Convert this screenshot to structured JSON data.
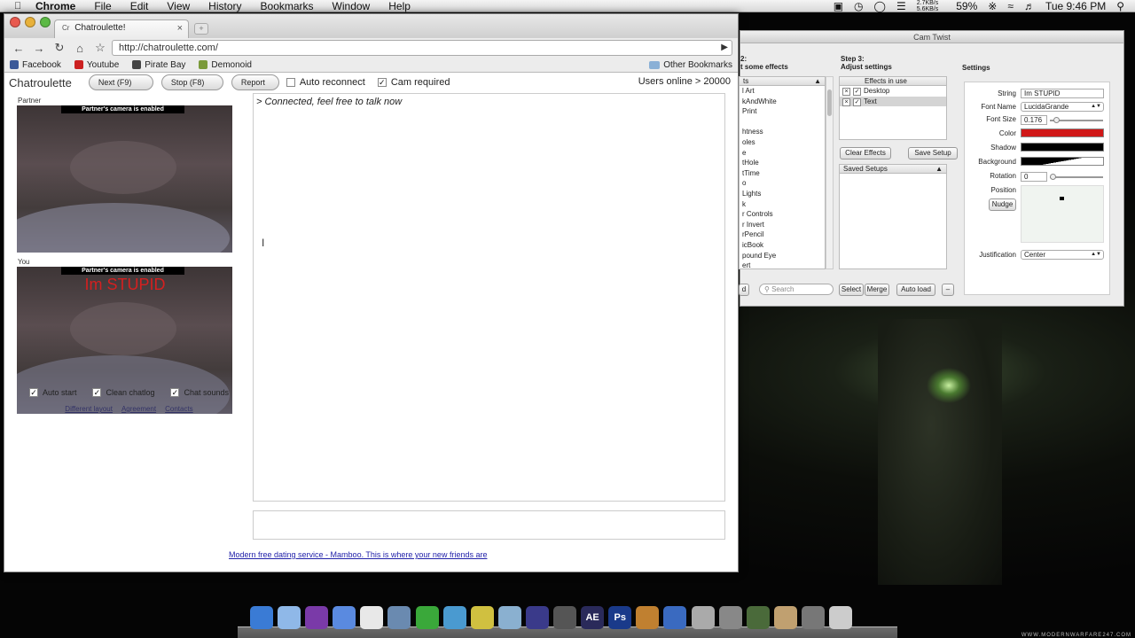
{
  "menubar": {
    "app": "Chrome",
    "items": [
      "File",
      "Edit",
      "View",
      "History",
      "Bookmarks",
      "Window",
      "Help"
    ],
    "netspeed_up": "2.7KB/s",
    "netspeed_down": "5.6KB/s",
    "battery": "59%",
    "clock": "Tue 9:46 PM"
  },
  "browser": {
    "tab_title": "Chatroulette!",
    "tab_favicon": "Cr",
    "url": "http://chatroulette.com/",
    "bookmarks": [
      "Facebook",
      "Youtube",
      "Pirate Bay",
      "Demonoid"
    ],
    "other_bookmarks": "Other Bookmarks"
  },
  "chatroulette": {
    "logo": "Chatroulette",
    "next_button": "Next (F9)",
    "stop_button": "Stop (F8)",
    "report_button": "Report",
    "auto_reconnect": "Auto reconnect",
    "cam_required": "Cam required",
    "users_online": "Users online > 20000",
    "partner_label": "Partner",
    "you_label": "You",
    "partner_cam_status": "Partner's camera is enabled",
    "you_cam_status": "Partner's camera is enabled",
    "overlay_text": "Im STUPID",
    "opt_auto_start": "Auto start",
    "opt_clean_chatlog": "Clean chatlog",
    "opt_chat_sounds": "Chat sounds",
    "link_layout": "Different layout",
    "link_agreement": "Agreement",
    "link_contacts": "Contacts",
    "chat_message": "> Connected, feel free to talk now",
    "ad_text": "Modern free dating service - Mamboo. This is where your new friends are"
  },
  "camtwist": {
    "title": "Cam Twist",
    "step2_line1": "2:",
    "step2_line2": "t some effects",
    "step3_line1": "Step 3:",
    "step3_line2": "Adjust settings",
    "settings_heading": "Settings",
    "effects_header": "ts",
    "effects": [
      "l Art",
      "kAndWhite",
      "Print",
      "",
      "htness",
      "oles",
      "e",
      "tHole",
      "tTime",
      "o",
      "Lights",
      "k",
      "r Controls",
      "r Invert",
      "rPencil",
      "icBook",
      "pound Eye",
      "ert"
    ],
    "effects_in_use_header": "Effects in use",
    "effects_in_use": [
      "Desktop",
      "Text"
    ],
    "clear_effects": "Clear Effects",
    "save_setup": "Save Setup",
    "saved_setups": "Saved Setups",
    "bottom_left_btn": "d",
    "search_placeholder": "Search",
    "select_btn": "Select",
    "merge_btn": "Merge",
    "autoload_btn": "Auto load",
    "minus_btn": "–",
    "string_label": "String",
    "string_value": "Im STUPID",
    "font_name_label": "Font Name",
    "font_name_value": "LucidaGrande",
    "font_size_label": "Font Size",
    "font_size_value": "0.176",
    "color_label": "Color",
    "shadow_label": "Shadow",
    "background_label": "Background",
    "rotation_label": "Rotation",
    "rotation_value": "0",
    "position_label": "Position",
    "nudge_btn": "Nudge",
    "justification_label": "Justification",
    "justification_value": "Center",
    "color_value": "#d01818",
    "shadow_value": "#000000"
  },
  "dock": {
    "apps": [
      "finder-icon",
      "itunes-icon",
      "imovie-icon",
      "ichat-icon",
      "chrome-icon",
      "preview-icon",
      "utorrent-icon",
      "xscope-icon",
      "imovie-star-icon",
      "iphoto-icon",
      "text-icon",
      "finalcut-icon",
      "after-effects-icon",
      "photoshop-icon",
      "photo-icon",
      "word-icon",
      "unknown-icon",
      "system-prefs-icon",
      "camtwist-icon",
      "trash-folder-icon",
      "disk-icon",
      "trash-icon"
    ],
    "ae_label": "AE",
    "ps_label": "Ps"
  },
  "watermark": "WWW.MODERNWARFARE247.COM"
}
